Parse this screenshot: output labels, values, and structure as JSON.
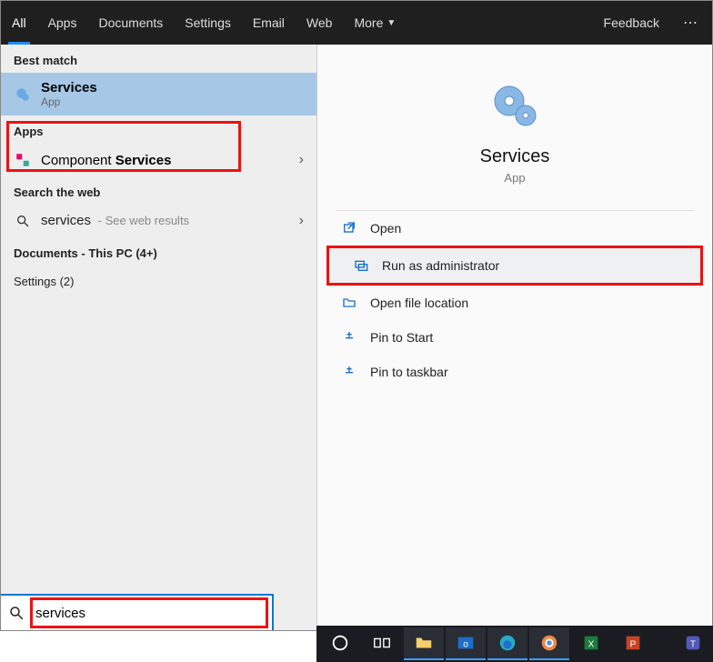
{
  "tabs": {
    "items": [
      "All",
      "Apps",
      "Documents",
      "Settings",
      "Email",
      "Web",
      "More"
    ],
    "active_index": 0,
    "feedback": "Feedback"
  },
  "left": {
    "best_match_header": "Best match",
    "best_match": {
      "title": "Services",
      "subtitle": "App"
    },
    "apps_header": "Apps",
    "apps_item": {
      "prefix": "Component ",
      "bold": "Services"
    },
    "web_header": "Search the web",
    "web_item": {
      "query": "services",
      "suffix": " - See web results"
    },
    "docs_header": "Documents - This PC (4+)",
    "settings_header": "Settings (2)"
  },
  "preview": {
    "title": "Services",
    "subtitle": "App",
    "actions": {
      "open": "Open",
      "run_admin": "Run as administrator",
      "open_location": "Open file location",
      "pin_start": "Pin to Start",
      "pin_taskbar": "Pin to taskbar"
    }
  },
  "search": {
    "value": "services"
  },
  "colors": {
    "accent": "#0078d4",
    "highlight": "#e11"
  }
}
